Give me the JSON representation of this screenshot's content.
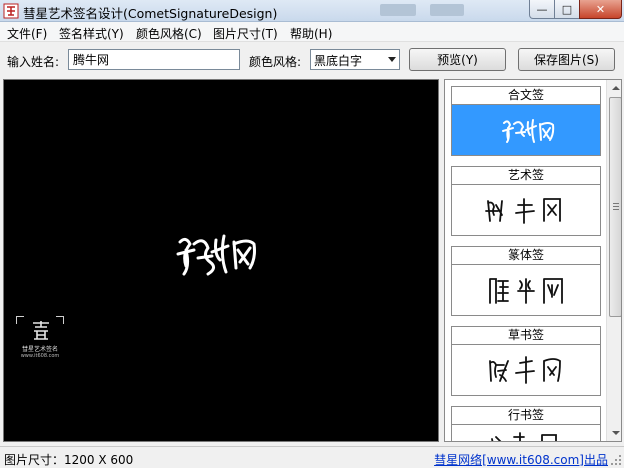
{
  "window": {
    "title": "彗星艺术签名设计(CometSignatureDesign)",
    "app_icon": "comet-seal-icon",
    "controls": {
      "minimize": "—",
      "maximize": "□",
      "close": "✕"
    }
  },
  "menu": [
    {
      "label": "文件(F)"
    },
    {
      "label": "签名样式(Y)"
    },
    {
      "label": "颜色风格(C)"
    },
    {
      "label": "图片尺寸(T)"
    },
    {
      "label": "帮助(H)"
    }
  ],
  "toolbar": {
    "name_label": "输入姓名:",
    "name_value": "腾牛网",
    "color_label": "颜色风格:",
    "color_value": "黑底白字",
    "preview_button": "预览(Y)",
    "save_button": "保存图片(S)"
  },
  "canvas": {
    "background": "#000000",
    "signature_text": "腾牛网",
    "watermark_text": "彗星艺术签名",
    "watermark_url": "www.it608.com"
  },
  "styles": [
    {
      "title": "合文签",
      "preview": "腾牛网",
      "selected": true
    },
    {
      "title": "艺术签",
      "preview": "腾 牛 网",
      "selected": false
    },
    {
      "title": "篆体签",
      "preview": "腾 牛 网",
      "selected": false
    },
    {
      "title": "草书签",
      "preview": "腾 牛 网",
      "selected": false
    },
    {
      "title": "行书签",
      "preview": "腾 牛 网",
      "selected": false
    }
  ],
  "status": {
    "size": "图片尺寸：1200 X 600",
    "credit": "彗星网络[www.it608.com]出品"
  },
  "colors": {
    "accent": "#3399ff",
    "link": "#0033cc"
  }
}
